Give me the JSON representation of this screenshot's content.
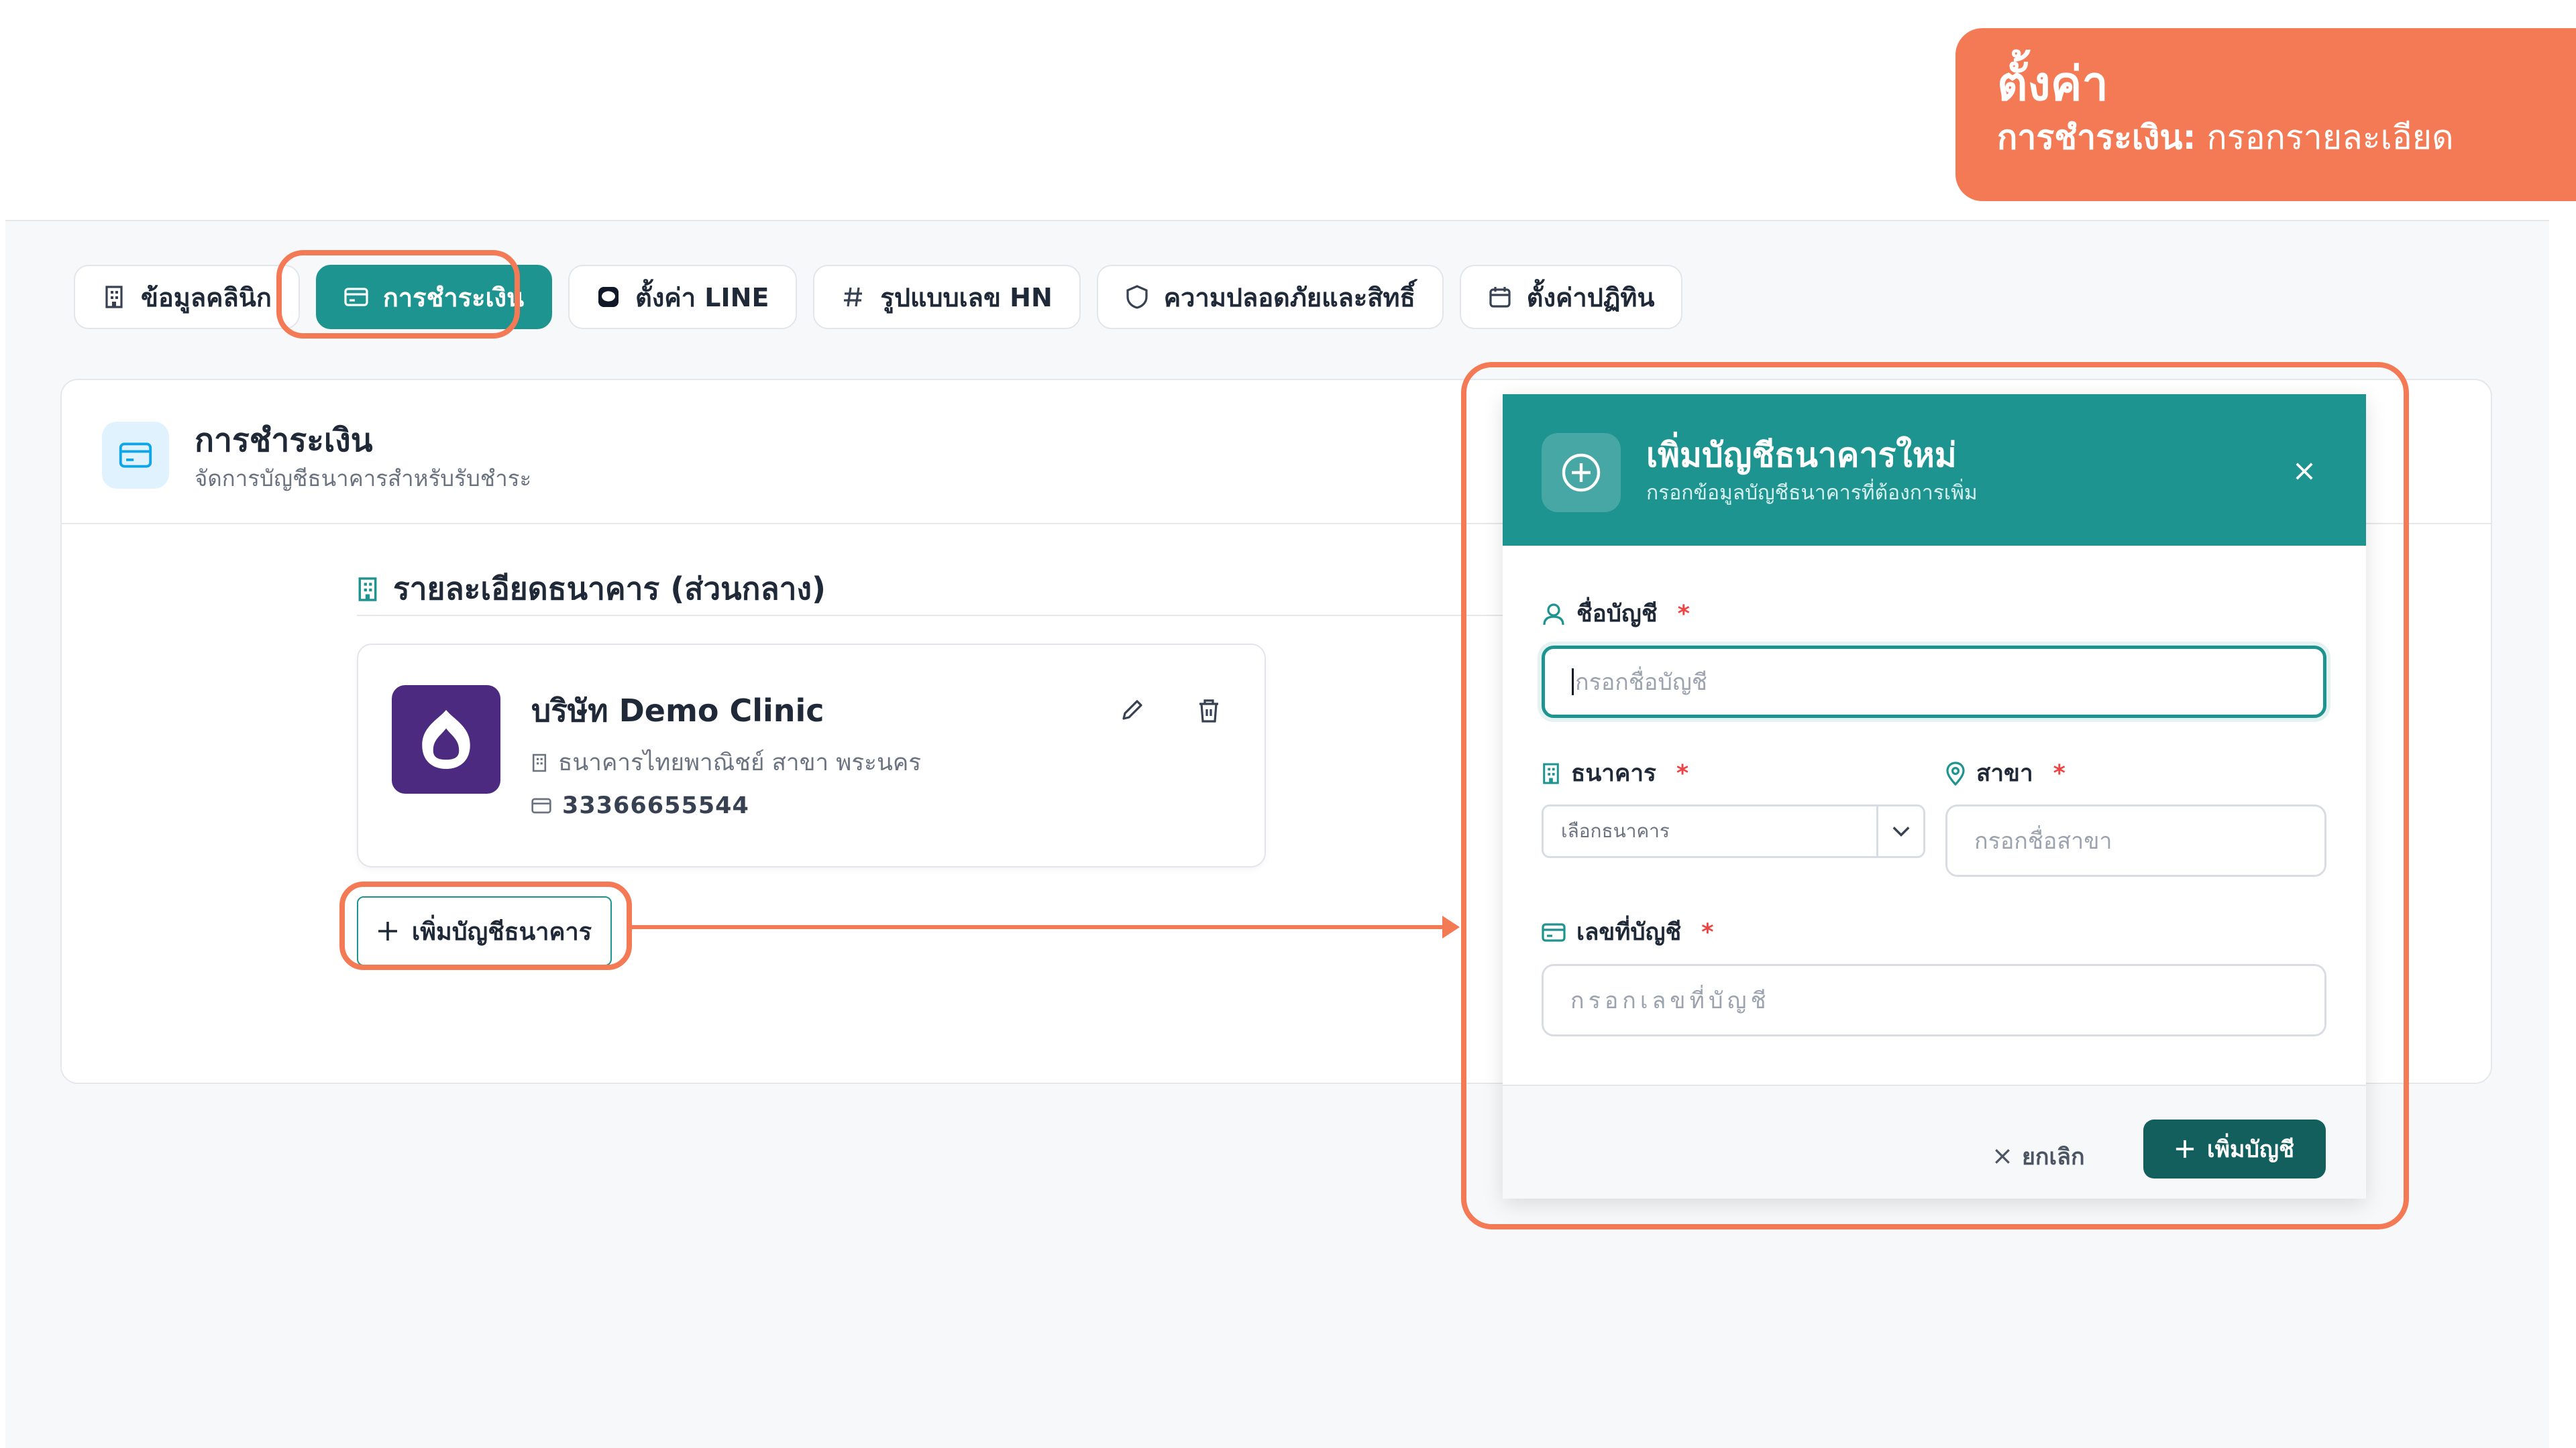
{
  "badge": {
    "title": "ตั้งค่า",
    "section": "การชำระเงิน:",
    "step": " กรอกรายละเอียด"
  },
  "tabs": [
    {
      "label": "ข้อมูลคลินิก",
      "icon": "building-icon"
    },
    {
      "label": "การชำระเงิน",
      "icon": "credit-card-icon"
    },
    {
      "label": "ตั้งค่า LINE",
      "icon": "line-chat-icon"
    },
    {
      "label": "รูปแบบเลข HN",
      "icon": "hash-icon"
    },
    {
      "label": "ความปลอดภัยและสิทธิ์",
      "icon": "shield-icon"
    },
    {
      "label": "ตั้งค่าปฏิทิน",
      "icon": "calendar-icon"
    }
  ],
  "card": {
    "title": "การชำระเงิน",
    "subtitle": "จัดการบัญชีธนาคารสำหรับรับชำระ",
    "section_title": "รายละเอียดธนาคาร (ส่วนกลาง)",
    "bank": {
      "name": "บริษัท Demo Clinic",
      "branch": "ธนาคารไทยพาณิชย์ สาขา พระนคร",
      "account": "33366655544",
      "logo_color": "#4b2a80"
    },
    "add_button": "เพิ่มบัญชีธนาคาร"
  },
  "modal": {
    "title": "เพิ่มบัญชีธนาคารใหม่",
    "subtitle": "กรอกข้อมูลบัญชีธนาคารที่ต้องการเพิ่ม",
    "account_name": {
      "label": "ชื่อบัญชี",
      "placeholder": "กรอกชื่อบัญชี"
    },
    "bank": {
      "label": "ธนาคาร",
      "placeholder": "เลือกธนาคาร"
    },
    "branch": {
      "label": "สาขา",
      "placeholder": "กรอกชื่อสาขา"
    },
    "account_number": {
      "label": "เลขที่บัญชี",
      "placeholder": "กรอกเลขที่บัญชี"
    },
    "required_mark": "*",
    "cancel": "ยกเลิก",
    "submit": "เพิ่มบัญชี"
  },
  "colors": {
    "accent": "#1e9490",
    "highlight": "#f47a55",
    "submit": "#125f5e"
  }
}
